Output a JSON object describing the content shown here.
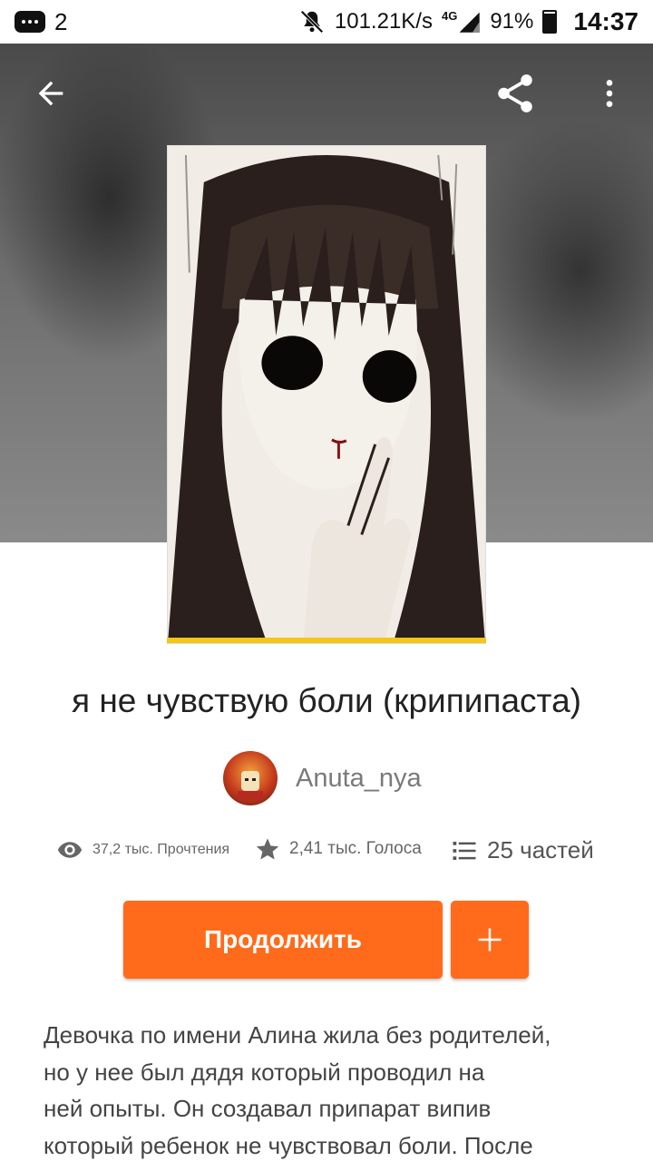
{
  "status_bar": {
    "notification_count": "2",
    "network_speed": "101.21K/s",
    "network_type": "4G",
    "battery": "91%",
    "time": "14:37"
  },
  "story": {
    "title": "я не чувствую боли (крипипаста)",
    "author": "Anuta_nya",
    "reads": "37,2 тыс. Прочтения",
    "votes": "2,41 тыс. Голоса",
    "parts": "25 частей",
    "description_lines": [
      "Девочка по имени Алина жила без родителей,",
      "но у нее был дядя который проводил на",
      "ней опыты. Он создавал припарат випив",
      "который ребенок не чувствовал боли. После"
    ]
  },
  "actions": {
    "continue_label": "Продолжить",
    "add_label": "+"
  },
  "colors": {
    "accent": "#ff6b1a",
    "cover_underline": "#f5c518"
  },
  "icons": [
    "back-arrow-icon",
    "share-icon",
    "more-vertical-icon",
    "eye-icon",
    "star-icon",
    "list-icon",
    "plus-icon"
  ]
}
